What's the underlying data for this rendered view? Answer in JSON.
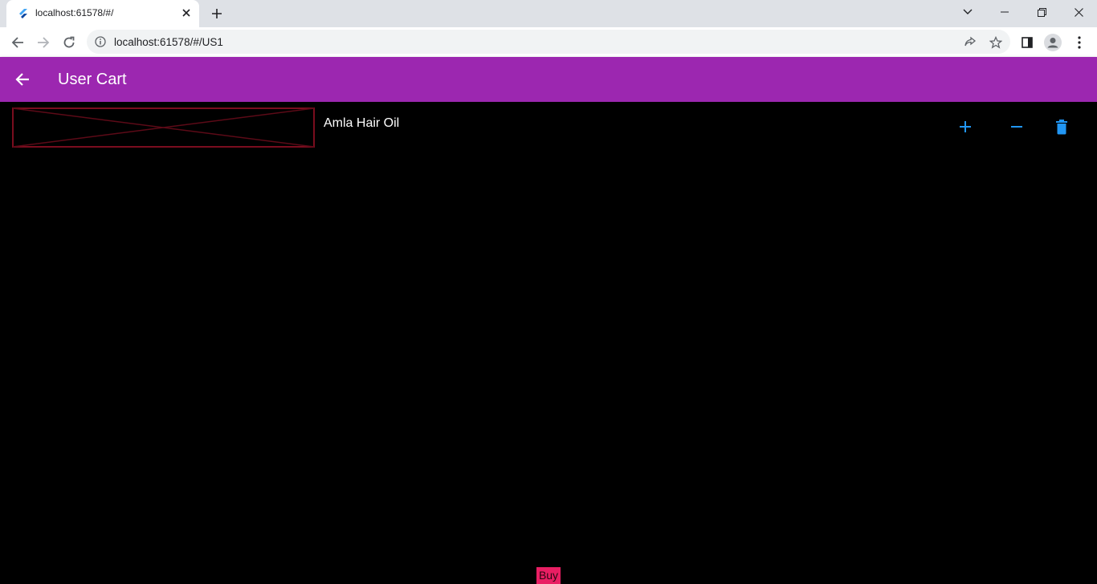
{
  "browser": {
    "tab_title": "localhost:61578/#/",
    "url": "localhost:61578/#/US1"
  },
  "appbar": {
    "title": "User Cart",
    "color": "#9c27b0"
  },
  "cart": {
    "items": [
      {
        "name": "Amla Hair Oil",
        "image_state": "broken-image-placeholder",
        "actions": [
          "add-icon",
          "remove-icon",
          "delete-icon"
        ]
      }
    ],
    "action_color": "#2196f3"
  },
  "footer": {
    "buy_label": "Buy",
    "buy_color": "#e91e63"
  }
}
